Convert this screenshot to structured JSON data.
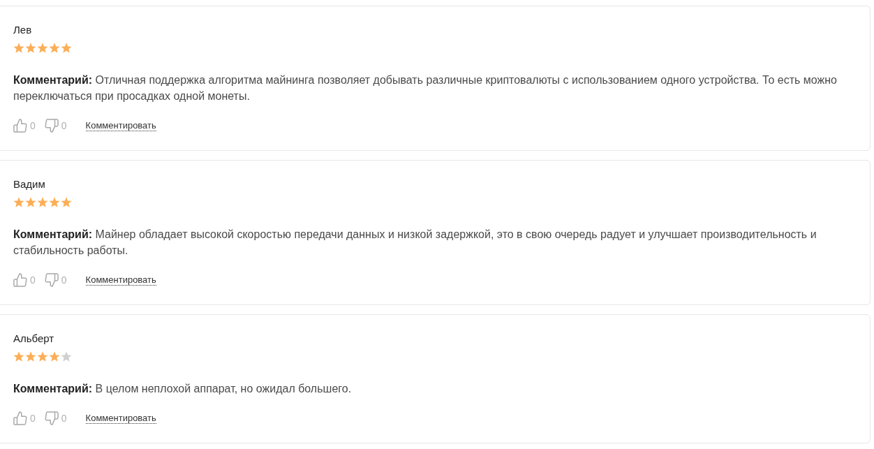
{
  "reviews": [
    {
      "author": "Лев",
      "stars": 5,
      "comment": "**Комментарий:** Отличная поддержка алгоритма майнинга позволяет добывать различные криптовалюты с использованием одного устройства. То есть можно переключаться при просадках одной монеты.",
      "likes": "0",
      "dislikes": "0",
      "reply_link": "Комментировать"
    },
    {
      "author": "Вадим",
      "stars": 5,
      "comment": "**Комментарий:** Майнер обладает высокой скоростью передачи данных и низкой задержкой, это в свою очередь радует и улучшает производительность и стабильность работы.",
      "likes": "0",
      "dislikes": "0",
      "reply_link": "Комментировать"
    },
    {
      "author": "Альберт",
      "stars": 4,
      "comment": "**Комментарий:** В целом неплохой аппарат, но ожидал большего.",
      "likes": "0",
      "dislikes": "0",
      "reply_link": "Комментировать"
    }
  ]
}
